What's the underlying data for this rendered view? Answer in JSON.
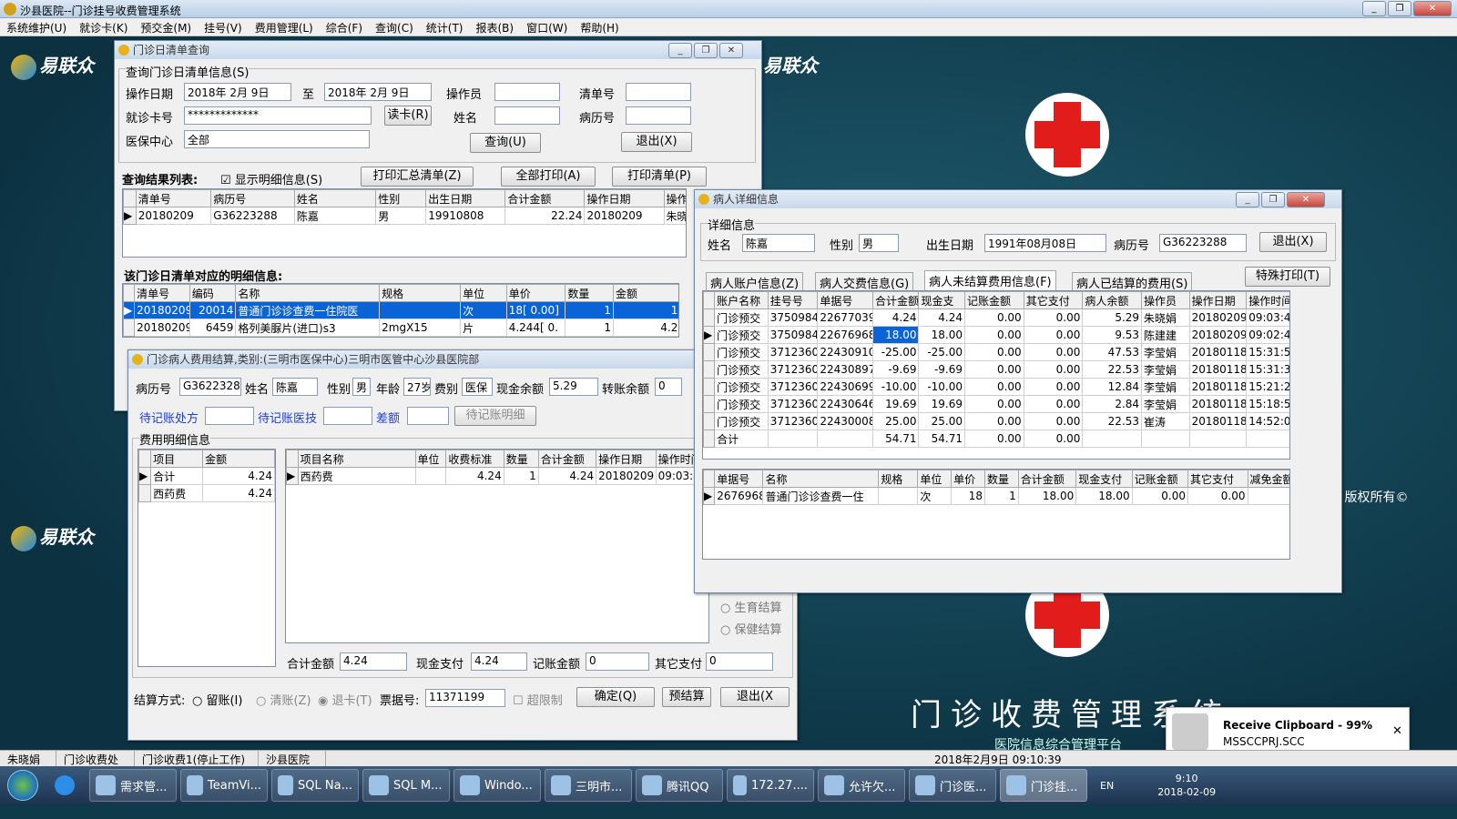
{
  "app": {
    "title": "沙县医院--门诊挂号收费管理系统"
  },
  "menu": [
    "系统维护(U)",
    "就诊卡(K)",
    "预交金(M)",
    "挂号(V)",
    "费用管理(L)",
    "综合(F)",
    "查询(C)",
    "统计(T)",
    "报表(B)",
    "窗口(W)",
    "帮助(H)"
  ],
  "desktop": {
    "brand": "易联众",
    "title": "门诊收费管理系统",
    "subtitle": "医院信息综合管理平台",
    "copyright": "司® 版权所有©"
  },
  "query_window": {
    "title": "门诊日清单查询",
    "group": "查询门诊日清单信息(S)",
    "op_date_label": "操作日期",
    "date_from": "2018年 2月 9日",
    "to_label": "至",
    "date_to": "2018年 2月 9日",
    "operator_label": "操作员",
    "operator": "",
    "list_no_label": "清单号",
    "list_no": "",
    "card_label": "就诊卡号",
    "card": "*************",
    "read_card": "读卡(R)",
    "name_label": "姓名",
    "name": "",
    "record_label": "病历号",
    "record": "",
    "insurance_label": "医保中心",
    "insurance": "全部",
    "query_btn": "查询(U)",
    "exit_btn": "退出(X)",
    "results_label": "查询结果列表:",
    "show_detail": "显示明细信息(S)",
    "print_summary": "打印汇总清单(Z)",
    "print_all": "全部打印(A)",
    "print_list": "打印清单(P)",
    "results_columns": [
      "清单号",
      "病历号",
      "姓名",
      "性别",
      "出生日期",
      "合计金额",
      "操作日期",
      "操作员"
    ],
    "results_rows": [
      [
        "20180209",
        "G36223288",
        "陈嘉",
        "男",
        "19910808",
        "22.24",
        "20180209",
        "朱晓娟"
      ]
    ],
    "detail_label": "该门诊日清单对应的明细信息:",
    "detail_columns": [
      "清单号",
      "编码",
      "名称",
      "规格",
      "单位",
      "单价",
      "数量",
      "金额"
    ],
    "detail_rows": [
      [
        "20180209",
        "20014",
        "普通门诊诊查费一住院医",
        "",
        "次",
        "18[ 0.00]",
        "1",
        "18"
      ],
      [
        "20180209",
        "6459",
        "格列美脲片(进口)s3",
        "2mgX15",
        "片",
        "4.244[ 0.",
        "1",
        "4.24"
      ]
    ]
  },
  "settle_window": {
    "title": "门诊病人费用结算,类别:(三明市医保中心)三明市医管中心沙县医院部",
    "record_label": "病历号",
    "record": "G36223288",
    "name_label": "姓名",
    "name": "陈嘉",
    "sex_label": "性别",
    "sex": "男",
    "age_label": "年龄",
    "age": "27岁",
    "fee_label": "费别",
    "fee": "医保",
    "cash_label": "现金余额",
    "cash": "5.29",
    "transfer_label": "转账余额",
    "transfer": "0",
    "pending_presc": "待记账处方",
    "pending_tech": "待记账医技",
    "diff": "差额",
    "pending_detail": "待记账明细",
    "fee_group": "费用明细信息",
    "left_columns": [
      "项目",
      "金额"
    ],
    "left_rows": [
      [
        "合计",
        "4.24"
      ],
      [
        "西药费",
        "4.24"
      ]
    ],
    "right_columns": [
      "项目名称",
      "单位",
      "收费标准",
      "数量",
      "合计金额",
      "操作日期",
      "操作时间"
    ],
    "right_rows": [
      [
        "西药费",
        "",
        "4.24",
        "1",
        "4.24",
        "20180209",
        "09:03:4"
      ]
    ],
    "total_label": "合计金额",
    "total": "4.24",
    "cash_pay_label": "现金支付",
    "cash_pay": "4.24",
    "acct_label": "记账金额",
    "acct": "0",
    "other_label": "其它支付",
    "other": "0",
    "birth_settle": "生育结算",
    "health_settle": "保健结算",
    "method_label": "结算方式:",
    "m1": "留账(I)",
    "m2": "清账(Z)",
    "m3": "退卡(T)",
    "ticket_label": "票据号:",
    "ticket": "11371199",
    "overlimit": "超限制",
    "confirm": "确定(Q)",
    "presettle": "预结算",
    "exit": "退出(X"
  },
  "patient_window": {
    "title": "病人详细信息",
    "group": "详细信息",
    "name_label": "姓名",
    "name": "陈嘉",
    "sex_label": "性别",
    "sex": "男",
    "birth_label": "出生日期",
    "birth": "1991年08月08日",
    "record_label": "病历号",
    "record": "G36223288",
    "exit": "退出(X)",
    "tabs": [
      "病人账户信息(Z)",
      "病人交费信息(G)",
      "病人未结算费用信息(F)",
      "病人已结算的费用(S)"
    ],
    "special_print": "特殊打印(T)",
    "columns": [
      "账户名称",
      "挂号号",
      "单据号",
      "合计金额",
      "现金支",
      "记账金额",
      "其它支付",
      "病人余额",
      "操作员",
      "操作日期",
      "操作时间"
    ],
    "rows": [
      [
        "门诊预交",
        "3750984",
        "22677039",
        "4.24",
        "4.24",
        "0.00",
        "0.00",
        "5.29",
        "朱晓娟",
        "20180209",
        "09:03:49"
      ],
      [
        "门诊预交",
        "3750984",
        "22676968",
        "18.00",
        "18.00",
        "0.00",
        "0.00",
        "9.53",
        "陈建建",
        "20180209",
        "09:02:42"
      ],
      [
        "门诊预交",
        "3712360",
        "22430910",
        "-25.00",
        "-25.00",
        "0.00",
        "0.00",
        "47.53",
        "李莹娟",
        "20180118",
        "15:31:55"
      ],
      [
        "门诊预交",
        "3712360",
        "22430897",
        "-9.69",
        "-9.69",
        "0.00",
        "0.00",
        "22.53",
        "李莹娟",
        "20180118",
        "15:31:39"
      ],
      [
        "门诊预交",
        "3712360",
        "22430699",
        "-10.00",
        "-10.00",
        "0.00",
        "0.00",
        "12.84",
        "李莹娟",
        "20180118",
        "15:21:25"
      ],
      [
        "门诊预交",
        "3712360",
        "22430646",
        "19.69",
        "19.69",
        "0.00",
        "0.00",
        "2.84",
        "李莹娟",
        "20180118",
        "15:18:52"
      ],
      [
        "门诊预交",
        "3712360",
        "22430008",
        "25.00",
        "25.00",
        "0.00",
        "0.00",
        "22.53",
        "崔涛",
        "20180118",
        "14:52:02"
      ]
    ],
    "total_row": [
      "合计",
      "",
      "",
      "54.71",
      "54.71",
      "0.00",
      "0.00",
      "",
      "",
      "",
      ""
    ],
    "detail_columns": [
      "单据号",
      "名称",
      "规格",
      "单位",
      "单价",
      "数量",
      "合计金额",
      "现金支付",
      "记账金额",
      "其它支付",
      "减免金额"
    ],
    "detail_rows": [
      [
        "2676968",
        "普通门诊诊查费一住",
        "",
        "次",
        "18",
        "1",
        "18.00",
        "18.00",
        "0.00",
        "0.00",
        ""
      ]
    ]
  },
  "status": {
    "user": "朱晓娟",
    "dept": "门诊收费处",
    "station": "门诊收费1(停止工作)",
    "hospital": "沙县医院",
    "datetime": "2018年2月9日 09:10:39"
  },
  "taskbar": {
    "items": [
      "需求管...",
      "TeamVi...",
      "SQL Na...",
      "SQL M...",
      "Windo...",
      "三明市...",
      "腾讯QQ",
      "172.27....",
      "允许欠...",
      "门诊医...",
      "门诊挂..."
    ],
    "lang": "EN",
    "time": "9:10",
    "date": "2018-02-09"
  },
  "toast": {
    "title": "Receive Clipboard - 99%",
    "file": "MSSCCPRJ.SCC"
  }
}
